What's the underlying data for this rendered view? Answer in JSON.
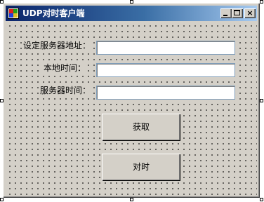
{
  "window": {
    "title": "UDP对时客户端",
    "minimize_label": "_",
    "maximize_label": "□",
    "close_label": "×"
  },
  "fields": {
    "server_address_label": "设定服务器地址：",
    "server_address_value": "",
    "local_time_label": "本地时间：",
    "local_time_value": "",
    "server_time_label": "服务器时间：",
    "server_time_value": ""
  },
  "buttons": {
    "get_label": "获取",
    "sync_label": "对时"
  }
}
